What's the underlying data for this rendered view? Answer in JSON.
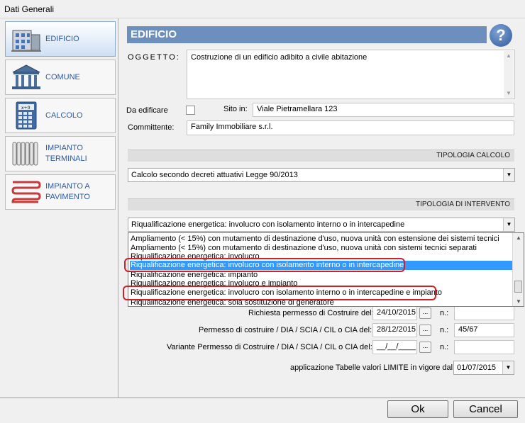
{
  "window": {
    "title": "Dati Generali"
  },
  "sidebar": {
    "items": [
      {
        "label": "EDIFICIO",
        "icon": "building-icon",
        "active": true
      },
      {
        "label": "COMUNE",
        "icon": "town-hall-icon",
        "active": false
      },
      {
        "label": "CALCOLO",
        "icon": "calculator-icon",
        "active": false
      },
      {
        "label": "IMPIANTO TERMINALI",
        "icon": "radiator-icon",
        "active": false
      },
      {
        "label": "IMPIANTO A PAVIMENTO",
        "icon": "floor-heating-icon",
        "active": false
      }
    ]
  },
  "header": {
    "title": "EDIFICIO",
    "help_label": "?"
  },
  "form": {
    "oggetto_label": "OGGETTO:",
    "oggetto_value": "Costruzione di un edificio adibito a civile abitazione",
    "da_edificare_label": "Da edificare",
    "da_edificare_checked": false,
    "sito_label": "Sito in:",
    "sito_value": "Viale Pietramellara 123",
    "committente_label": "Committente:",
    "committente_value": "Family Immobiliare s.r.l."
  },
  "tipologia_calcolo": {
    "section_label": "TIPOLOGIA CALCOLO",
    "selected": "Calcolo secondo decreti attuativi Legge 90/2013"
  },
  "tipologia_intervento": {
    "section_label": "TIPOLOGIA DI INTERVENTO",
    "selected": "Riqualificazione energetica: involucro con isolamento interno o in intercapedine",
    "options": [
      "Ampliamento (< 15%) con mutamento di destinazione d'uso, nuova unità con estensione dei sistemi tecnici",
      "Ampliamento (< 15%) con mutamento di destinazione d'uso, nuova unità con sistemi tecnici separati",
      "Riqualificazione energetica: involucro",
      "Riqualificazione energetica: involucro con isolamento interno o in intercapedine",
      "Riqualificazione energetica: impianto",
      "Riqualificazione energetica: involucro e impianto",
      "Riqualificazione energetica: involucro con isolamento interno o in intercapedine e impianto",
      "Riqualificazione energetica: sola sostituzione di generatore"
    ],
    "highlighted_index": 3
  },
  "permessi": {
    "richiesta_label": "Richiesta permesso di Costruire del:",
    "richiesta_date": "24/10/2015",
    "richiesta_n": "",
    "permesso_label": "Permesso di costruire / DIA / SCIA / CIL o CIA del:",
    "permesso_date": "28/12/2015",
    "permesso_n": "45/67",
    "variante_label": "Variante Permesso di Costruire / DIA / SCIA / CIL o CIA del:",
    "variante_date": "__/__/____",
    "variante_n": "",
    "n_label": "n.:",
    "date_button": "..."
  },
  "tabelle": {
    "label": "applicazione Tabelle valori LIMITE in vigore dal",
    "value": "01/07/2015"
  },
  "footer": {
    "ok": "Ok",
    "cancel": "Cancel"
  },
  "colors": {
    "header": "#6d8fbe",
    "highlight": "#d0202a",
    "selection": "#3399ff",
    "nav_text": "#2a5aa8"
  }
}
